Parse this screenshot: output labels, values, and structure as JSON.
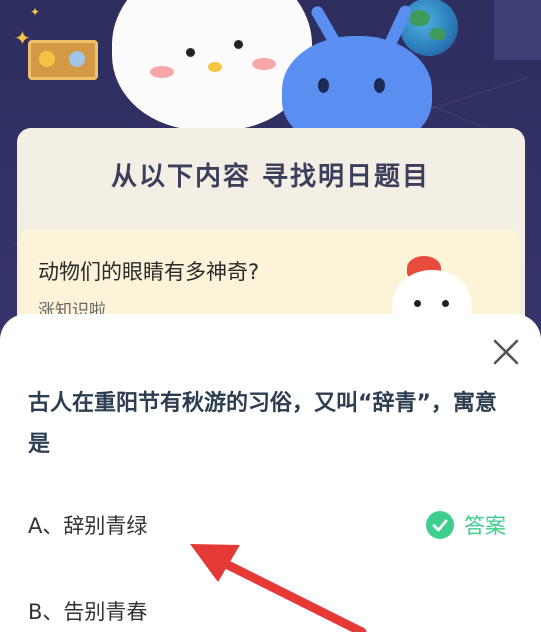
{
  "background": {
    "card_title": "从以下内容 寻找明日题目",
    "quiz_card": {
      "title": "动物们的眼睛有多神奇?",
      "subtitle": "涨知识啦"
    }
  },
  "sheet": {
    "question": "古人在重阳节有秋游的习俗，又叫“辞青”，寓意是",
    "options": [
      {
        "label": "A、辞别青绿"
      },
      {
        "label": "B、告别青春"
      }
    ],
    "answer_label": "答案",
    "close_icon": "close-icon",
    "check_icon": "check-icon"
  },
  "colors": {
    "accent_green": "#3ecf8e",
    "arrow_red": "#e53935",
    "question_text": "#2c3e50"
  }
}
